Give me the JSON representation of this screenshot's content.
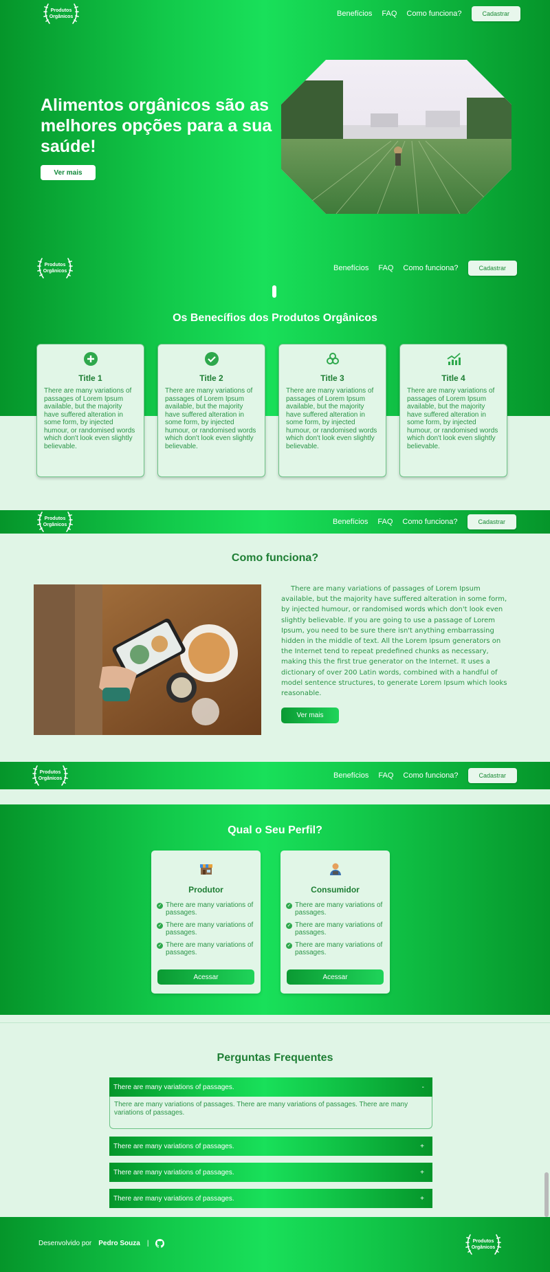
{
  "logo": {
    "text": "Produtos Orgânicos"
  },
  "nav": {
    "link1": "Benefícios",
    "link2": "FAQ",
    "link3": "Como funciona?",
    "signup": "Cadastrar"
  },
  "hero": {
    "title": "Alimentos orgânicos são as melhores opções para a sua saúde!",
    "button": "Ver mais"
  },
  "benefits": {
    "title": "Os Benecífios dos Produtos Orgânicos",
    "cards": [
      {
        "title": "Title 1",
        "icon": "plus-circle-icon",
        "text": "There are many variations of passages of Lorem Ipsum available, but the majority have suffered alteration in some form, by injected humour, or randomised words which don't look even slightly believable."
      },
      {
        "title": "Title 2",
        "icon": "check-circle-icon",
        "text": "There are many variations of passages of Lorem Ipsum available, but the majority have suffered alteration in some form, by injected humour, or randomised words which don't look even slightly believable."
      },
      {
        "title": "Title 3",
        "icon": "biohazard-icon",
        "text": "There are many variations of passages of Lorem Ipsum available, but the majority have suffered alteration in some form, by injected humour, or randomised words which don't look even slightly believable."
      },
      {
        "title": "Title 4",
        "icon": "chart-growth-icon",
        "text": "There are many variations of passages of Lorem Ipsum available, but the majority have suffered alteration in some form, by injected humour, or randomised words which don't look even slightly believable."
      }
    ]
  },
  "how": {
    "title": "Como funciona?",
    "text": "There are many variations of passages of Lorem Ipsum available, but the majority have suffered alteration in some form, by injected humour, or randomised words which don't look even slightly believable. If you are going to use a passage of Lorem Ipsum, you need to be sure there isn't anything embarrassing hidden in the middle of text. All the Lorem Ipsum generators on the Internet tend to repeat predefined chunks as necessary, making this the first true generator on the Internet. It uses a dictionary of over 200 Latin words, combined with a handful of model sentence structures, to generate Lorem Ipsum which looks reasonable.",
    "button": "Ver mais"
  },
  "profile": {
    "title": "Qual o Seu Perfil?",
    "cards": [
      {
        "title": "Produtor",
        "icon": "market-stall-icon",
        "items": [
          "There are many variations of passages.",
          "There are many variations of passages.",
          "There are many variations of passages."
        ],
        "button": "Acessar"
      },
      {
        "title": "Consumidor",
        "icon": "person-icon",
        "items": [
          "There are many variations of passages.",
          "There are many variations of passages.",
          "There are many variations of passages."
        ],
        "button": "Acessar"
      }
    ]
  },
  "faq": {
    "title": "Perguntas Frequentes",
    "items": [
      {
        "q": "There are many variations of passages.",
        "toggle": "-",
        "a": "There are many variations of passages. There are many variations of passages. There are many variations of passages."
      },
      {
        "q": "There are many variations of passages.",
        "toggle": "+"
      },
      {
        "q": "There are many variations of passages.",
        "toggle": "+"
      },
      {
        "q": "There are many variations of passages.",
        "toggle": "+"
      }
    ]
  },
  "footer": {
    "dev_label": "Desenvolvido por",
    "dev_name": "Pedro Souza",
    "separator": "|",
    "icon": "github-icon"
  },
  "colors": {
    "primary": "#0fb843",
    "light_bg": "#e0f5e6",
    "text_green": "#1e7e34"
  }
}
